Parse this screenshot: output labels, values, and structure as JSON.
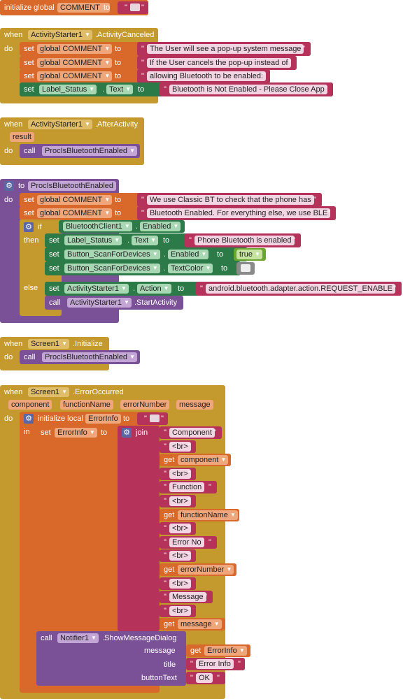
{
  "w": {
    "initialize_global": "initialize global",
    "to": "to",
    "when": "when",
    "do": "do",
    "set": "set",
    "call": "call",
    "global": "global",
    "if": "if",
    "then": "then",
    "else": "else",
    "in": "in",
    "join": "join",
    "get": "get",
    "initialize_local": "initialize local",
    "true": "true",
    "dot": "."
  },
  "global_var": {
    "name": "COMMENT"
  },
  "evt1": {
    "component": "ActivityStarter1",
    "event": ".ActivityCanceled",
    "texts": [
      "The User will see a pop-up system message",
      "If the User cancels the pop-up instead of",
      "allowing Bluetooth to be enabled:",
      "Bluetooth is Not Enabled - Please Close App"
    ],
    "label_component": "Label_Status",
    "label_prop": "Text"
  },
  "evt2": {
    "component": "ActivityStarter1",
    "event": ".AfterActivity",
    "param": "result",
    "proc": "ProcIsBluetoothEnabled"
  },
  "proc": {
    "name": "ProcIsBluetoothEnabled",
    "texts": [
      "We use Classic BT to check that the phone has",
      "Bluetooth Enabled. For everything else, we use BLE"
    ],
    "cond_component": "BluetoothClient1",
    "cond_prop": "Enabled",
    "then_label": "Label_Status",
    "then_label_prop": "Text",
    "then_label_text": "Phone Bluetooth is enabled",
    "scan_button": "Button_ScanForDevices",
    "scan_prop1": "Enabled",
    "scan_prop2": "TextColor",
    "else_component": "ActivityStarter1",
    "else_prop": "Action",
    "else_text": "android.bluetooth.adapter.action.REQUEST_ENABLE",
    "else_call": ".StartActivity"
  },
  "evt3": {
    "component": "Screen1",
    "event": ".Initialize",
    "proc": "ProcIsBluetoothEnabled"
  },
  "evt4": {
    "component": "Screen1",
    "event": ".ErrorOccurred",
    "params": [
      "component",
      "functionName",
      "errorNumber",
      "message"
    ],
    "local_var": "ErrorInfo",
    "join_items": [
      "Component",
      "<br>",
      "component",
      "<br>",
      "Function",
      "<br>",
      "functionName",
      "<br>",
      "Error No",
      "<br>",
      "errorNumber",
      "<br>",
      "Message",
      "<br>",
      "message"
    ],
    "notifier": "Notifier1",
    "notifier_method": ".ShowMessageDialog",
    "arg_message": "message",
    "arg_title": "title",
    "arg_button": "buttonText",
    "title_text": "Error Info",
    "button_text": "OK"
  },
  "colors": {
    "event": "#c49a2f",
    "procedure": "#7a5196",
    "variable": "#d9692a",
    "text": "#b5325b",
    "component": "#2c7a47",
    "logic": "#6aa52f"
  }
}
